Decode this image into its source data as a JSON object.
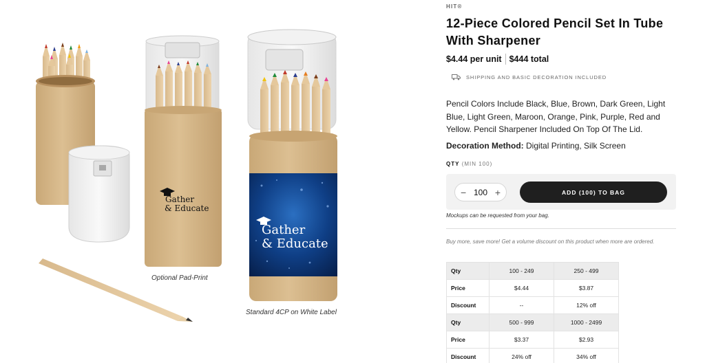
{
  "product_images": {
    "label_brand_line1": "Gather",
    "label_brand_line2": "& Educate",
    "caption_middle": "Optional Pad-Print",
    "caption_right": "Standard 4CP on White Label"
  },
  "product": {
    "brand": "HIT®",
    "title": "12-Piece Colored Pencil Set In Tube With Sharpener",
    "price_unit": "$4.44 per unit",
    "price_total": "$444 total",
    "shipping_note": "SHIPPING AND BASIC DECORATION INCLUDED",
    "description": "Pencil Colors Include Black, Blue, Brown, Dark Green, Light Blue, Light Green, Maroon, Orange, Pink, Purple, Red and Yellow. Pencil Sharpener Included On Top Of The Lid.",
    "decoration_label": "Decoration Method:",
    "decoration_value": "Digital Printing, Silk Screen"
  },
  "purchase": {
    "qty_label": "QTY",
    "qty_min": "(MIN 100)",
    "qty_value": "100",
    "minus": "−",
    "plus": "+",
    "add_button": "ADD (100) TO BAG",
    "mockups_note": "Mockups can be requested from your bag.",
    "volume_note": "Buy more, save more! Get a volume discount on this product when more are ordered."
  },
  "price_table": {
    "groups": [
      {
        "qty_label": "Qty",
        "ranges": [
          "100 - 249",
          "250 - 499"
        ],
        "price_label": "Price",
        "prices": [
          "$4.44",
          "$3.87"
        ],
        "discount_label": "Discount",
        "discounts": [
          "--",
          "12% off"
        ]
      },
      {
        "qty_label": "Qty",
        "ranges": [
          "500 - 999",
          "1000 - 2499"
        ],
        "price_label": "Price",
        "prices": [
          "$3.37",
          "$2.93"
        ],
        "discount_label": "Discount",
        "discounts": [
          "24% off",
          "34% off"
        ]
      }
    ]
  },
  "icons": {
    "shipping": "truck-icon",
    "logo_mark": "graduation-cap-icon"
  },
  "colors": {
    "button_bg": "#1f1f1f",
    "kraft": "#d2b48c",
    "label_blue": "#0d3a7a"
  }
}
